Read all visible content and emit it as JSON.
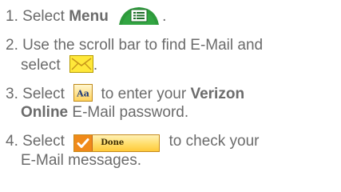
{
  "steps": [
    {
      "number": "1.",
      "text_before": "Select",
      "bold": "Menu",
      "icon": "menu-key-icon",
      "end": "."
    },
    {
      "number": "2.",
      "line1": "Use the scroll bar to find E-Mail and",
      "line2_text": "select",
      "icon": "mail-envelope-icon",
      "end": "."
    },
    {
      "number": "3.",
      "text_before": "Select",
      "icon": "aa-icon",
      "icon_label": "Aa",
      "text_after": "to enter your",
      "bold": "Verizon",
      "line2_bold": "Online",
      "line2_text": "E-Mail password."
    },
    {
      "number": "4.",
      "text_before": "Select",
      "icon": "done-button",
      "button_label": "Done",
      "text_after": "to check your",
      "line2_text": "E-Mail messages."
    }
  ],
  "colors": {
    "text": "#6b6b6b",
    "menu_key_green": "#2e9a3c",
    "mail_yellow": "#ffe83a",
    "done_orange": "#f08a1a"
  }
}
